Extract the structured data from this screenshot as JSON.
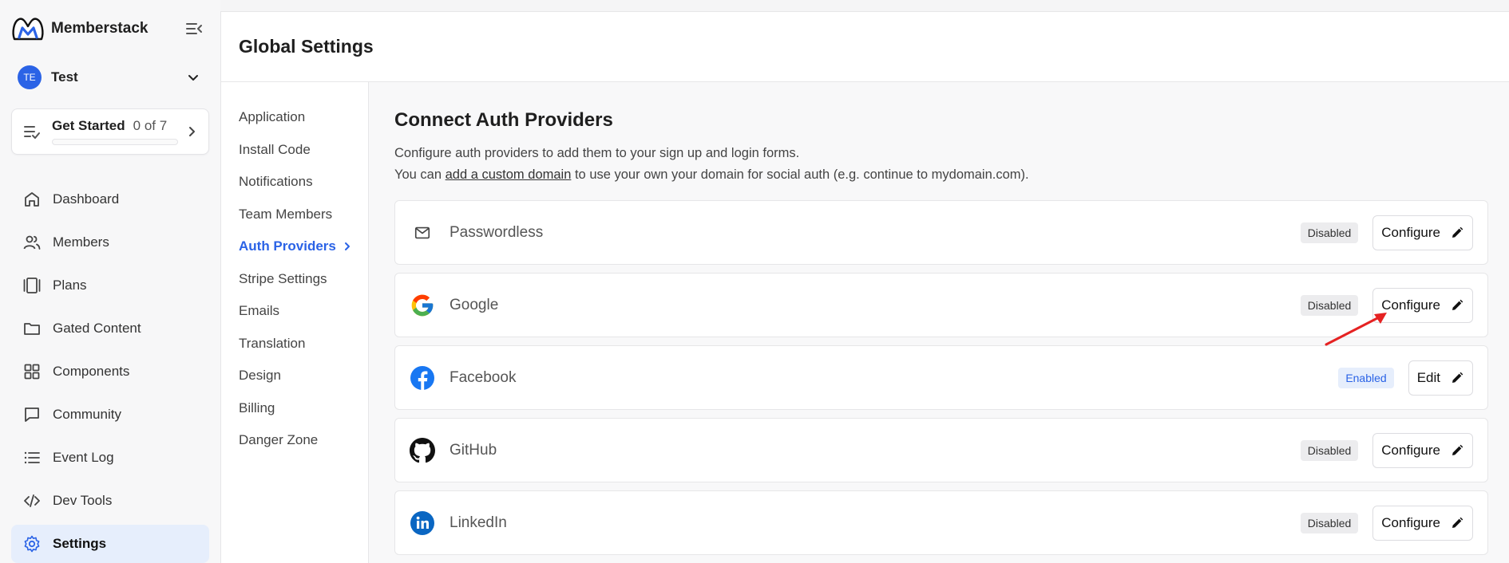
{
  "brand": {
    "name": "Memberstack"
  },
  "workspace": {
    "initials": "TE",
    "name": "Test"
  },
  "get_started": {
    "title": "Get Started",
    "count": "0 of 7",
    "progress": 0
  },
  "sidebar": {
    "items": [
      {
        "label": "Dashboard",
        "icon": "home-icon"
      },
      {
        "label": "Members",
        "icon": "users-icon"
      },
      {
        "label": "Plans",
        "icon": "plans-icon"
      },
      {
        "label": "Gated Content",
        "icon": "folder-icon"
      },
      {
        "label": "Components",
        "icon": "grid-icon"
      },
      {
        "label": "Community",
        "icon": "chat-icon"
      },
      {
        "label": "Event Log",
        "icon": "list-icon"
      },
      {
        "label": "Dev Tools",
        "icon": "code-icon"
      },
      {
        "label": "Settings",
        "icon": "gear-icon",
        "active": true
      }
    ]
  },
  "page": {
    "title": "Global Settings"
  },
  "subnav": {
    "items": [
      "Application",
      "Install Code",
      "Notifications",
      "Team Members",
      "Auth Providers",
      "Stripe Settings",
      "Emails",
      "Translation",
      "Design",
      "Billing",
      "Danger Zone"
    ],
    "active": "Auth Providers"
  },
  "panel": {
    "title": "Connect Auth Providers",
    "line1": "Configure auth providers to add them to your sign up and login forms.",
    "line2_prefix": "You can ",
    "line2_link": "add a custom domain",
    "line2_suffix": " to use your own your domain for social auth (e.g. continue to mydomain.com)."
  },
  "providers": [
    {
      "name": "Passwordless",
      "status": "Disabled",
      "action": "Configure",
      "icon": "mail-icon"
    },
    {
      "name": "Google",
      "status": "Disabled",
      "action": "Configure",
      "icon": "google-icon"
    },
    {
      "name": "Facebook",
      "status": "Enabled",
      "action": "Edit",
      "icon": "facebook-icon"
    },
    {
      "name": "GitHub",
      "status": "Disabled",
      "action": "Configure",
      "icon": "github-icon"
    },
    {
      "name": "LinkedIn",
      "status": "Disabled",
      "action": "Configure",
      "icon": "linkedin-icon"
    }
  ],
  "colors": {
    "accent": "#2b63e6",
    "annotation": "#e52222"
  }
}
